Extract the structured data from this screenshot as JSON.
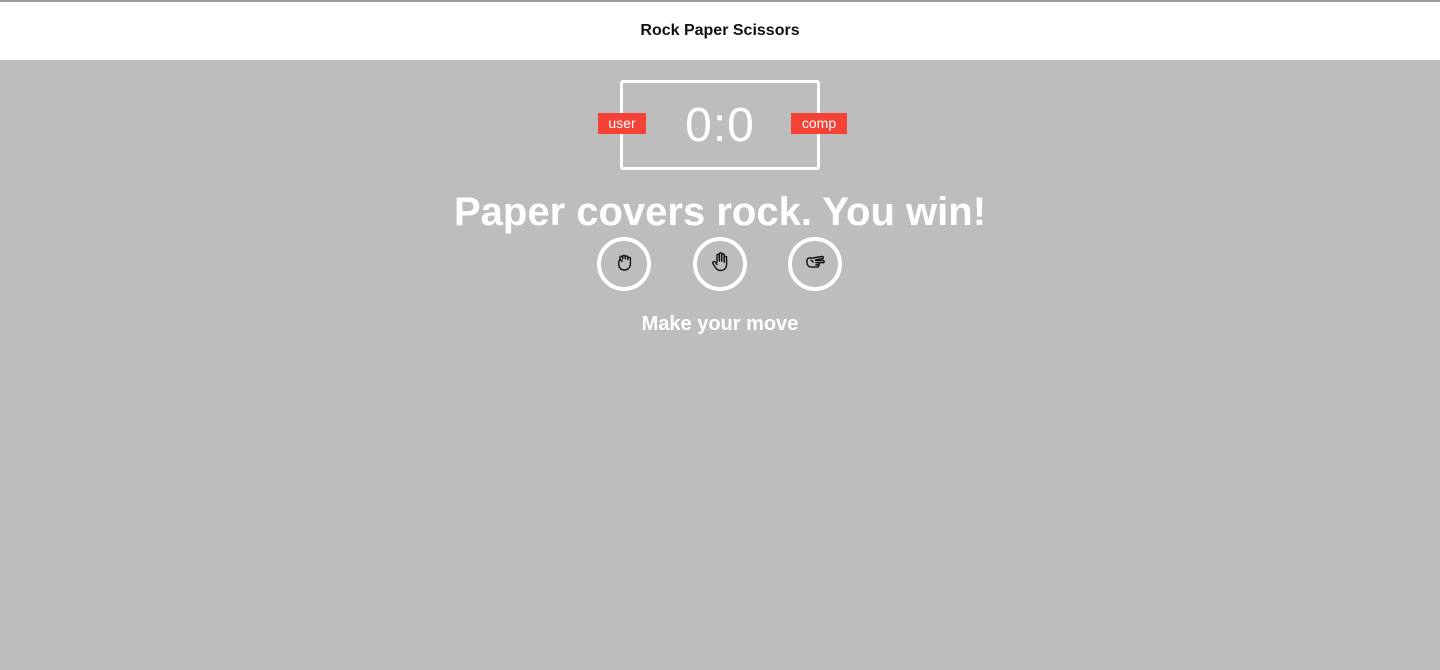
{
  "header": {
    "title": "Rock Paper Scissors"
  },
  "scoreboard": {
    "score": "0:0",
    "user_label": "user",
    "comp_label": "comp",
    "badge_color": "#f44336"
  },
  "result": {
    "message": "Paper covers rock. You win!"
  },
  "choices": [
    {
      "name": "rock",
      "icon": "hand-fist-icon"
    },
    {
      "name": "paper",
      "icon": "hand-open-icon"
    },
    {
      "name": "scissors",
      "icon": "hand-scissors-icon"
    }
  ],
  "prompt": {
    "text": "Make your move"
  },
  "colors": {
    "background": "#bdbdbd",
    "header_background": "#ffffff",
    "accent": "#ffffff"
  }
}
